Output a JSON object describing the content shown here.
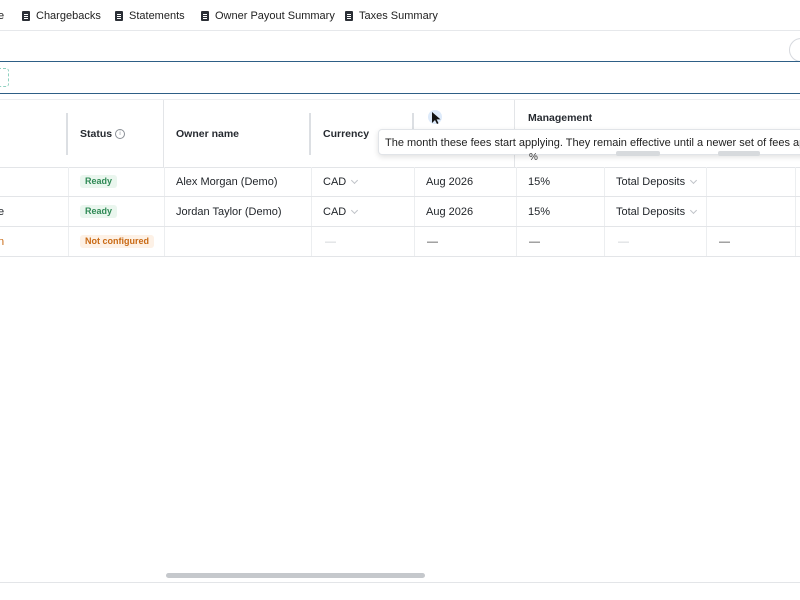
{
  "tabs": [
    {
      "label": "e",
      "icon": "none"
    },
    {
      "label": "Chargebacks",
      "icon": "document-icon"
    },
    {
      "label": "Statements",
      "icon": "document-icon"
    },
    {
      "label": "Owner Payout Summary",
      "icon": "document-icon"
    },
    {
      "label": "Taxes Summary",
      "icon": "document-icon"
    }
  ],
  "table": {
    "headers": {
      "status": "Status",
      "owner_name": "Owner name",
      "currency": "Currency",
      "management": "Management"
    },
    "rows": [
      {
        "prefix": "",
        "status": "Ready",
        "owner": "Alex Morgan (Demo)",
        "currency": "CAD",
        "month": "Aug 2026",
        "pct": "15%",
        "basis": "Total Deposits",
        "extra": "",
        "row_dash": ""
      },
      {
        "prefix": "e",
        "status": "Ready",
        "owner": "Jordan Taylor (Demo)",
        "currency": "CAD",
        "month": "Aug 2026",
        "pct": "15%",
        "basis": "Total Deposits",
        "extra": "",
        "row_dash": ""
      },
      {
        "prefix": "n",
        "status": "Not configured",
        "owner": "",
        "currency": "—",
        "month": "—",
        "pct": "—",
        "basis": "—",
        "extra": "—",
        "row_dash": "—"
      }
    ]
  },
  "tooltip": {
    "text": "The month these fees start applying. They remain effective until a newer set of fees applies.",
    "percent_label": "%"
  },
  "colors": {
    "ready_text": "#2f8a55",
    "not_configured_text": "#c96a14",
    "search_border": "#2e5f86"
  }
}
